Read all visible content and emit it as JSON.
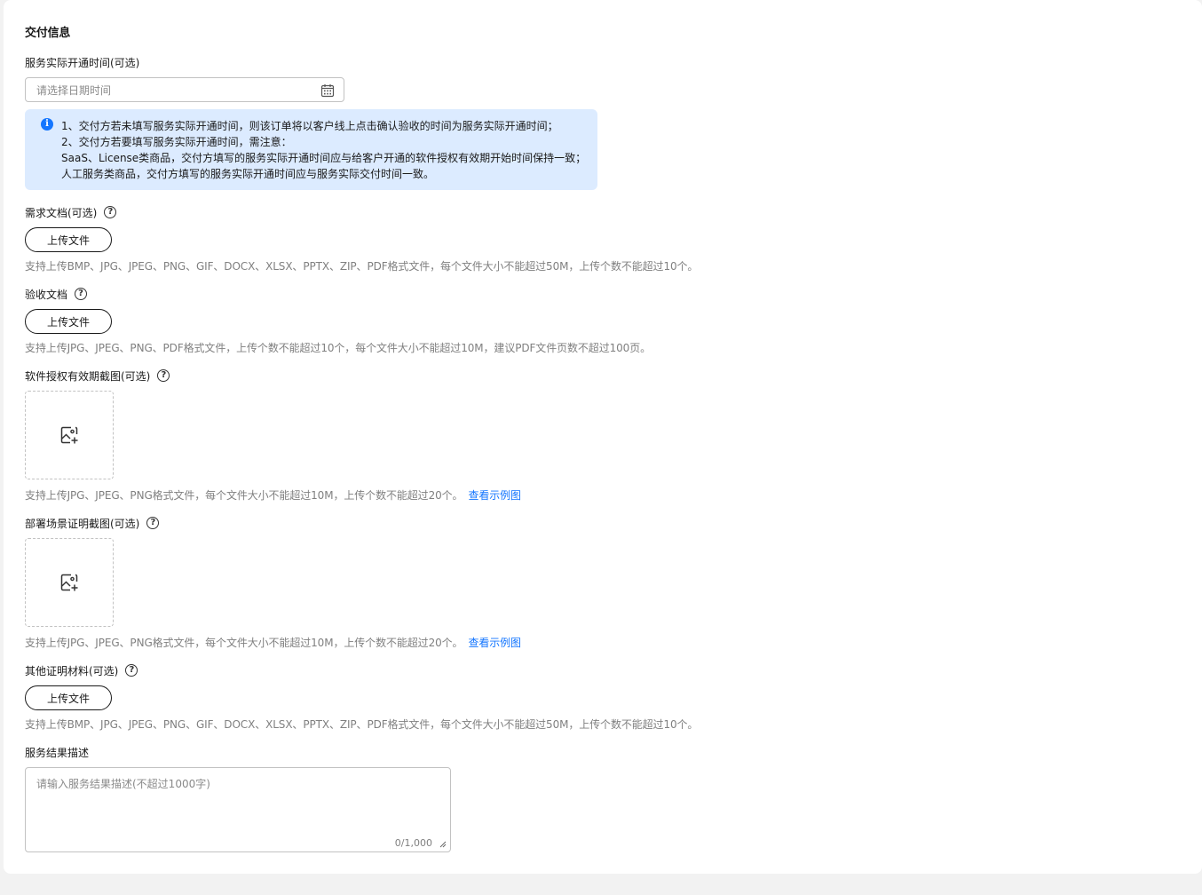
{
  "section": {
    "title": "交付信息"
  },
  "service_start": {
    "label": "服务实际开通时间(可选)",
    "placeholder": "请选择日期时间"
  },
  "notice": {
    "lines": [
      "1、交付方若未填写服务实际开通时间，则该订单将以客户线上点击确认验收的时间为服务实际开通时间；",
      "2、交付方若要填写服务实际开通时间，需注意：",
      "SaaS、License类商品，交付方填写的服务实际开通时间应与给客户开通的软件授权有效期开始时间保持一致；",
      "人工服务类商品，交付方填写的服务实际开通时间应与服务实际交付时间一致。"
    ]
  },
  "requirement_doc": {
    "label": "需求文档(可选)",
    "button": "上传文件",
    "hint": "支持上传BMP、JPG、JPEG、PNG、GIF、DOCX、XLSX、PPTX、ZIP、PDF格式文件，每个文件大小不能超过50M，上传个数不能超过10个。"
  },
  "acceptance_doc": {
    "label": "验收文档",
    "button": "上传文件",
    "hint": "支持上传JPG、JPEG、PNG、PDF格式文件，上传个数不能超过10个，每个文件大小不能超过10M，建议PDF文件页数不超过100页。"
  },
  "license_screenshot": {
    "label": "软件授权有效期截图(可选)",
    "hint": "支持上传JPG、JPEG、PNG格式文件，每个文件大小不能超过10M，上传个数不能超过20个。",
    "link": "查看示例图"
  },
  "deploy_screenshot": {
    "label": "部署场景证明截图(可选)",
    "hint": "支持上传JPG、JPEG、PNG格式文件，每个文件大小不能超过10M，上传个数不能超过20个。",
    "link": "查看示例图"
  },
  "other_material": {
    "label": "其他证明材料(可选)",
    "button": "上传文件",
    "hint": "支持上传BMP、JPG、JPEG、PNG、GIF、DOCX、XLSX、PPTX、ZIP、PDF格式文件，每个文件大小不能超过50M，上传个数不能超过10个。"
  },
  "result_desc": {
    "label": "服务结果描述",
    "placeholder": "请输入服务结果描述(不超过1000字)",
    "counter": "0/1,000"
  },
  "icons": {
    "help": "help-circle-icon",
    "info": "info-icon",
    "calendar": "calendar-icon",
    "image_add": "image-add-icon"
  },
  "colors": {
    "accent": "#1476ff",
    "notice_bg": "#dcebff",
    "hint_text": "#808080"
  }
}
